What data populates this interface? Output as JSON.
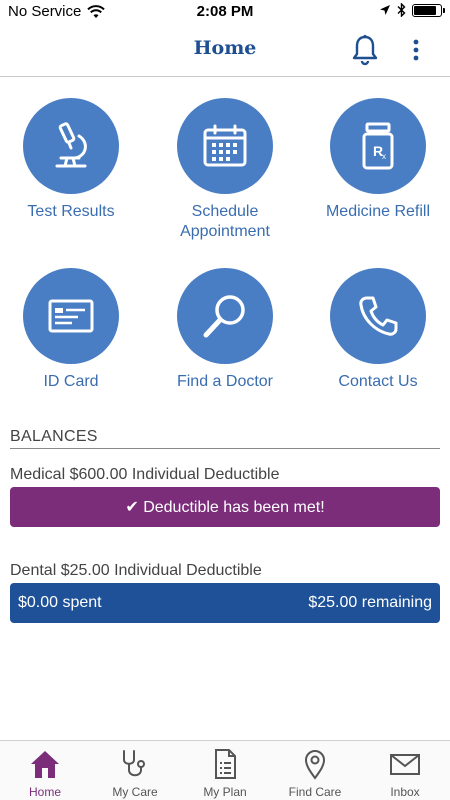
{
  "status": {
    "carrier": "No Service",
    "time": "2:08 PM"
  },
  "header": {
    "title": "Home"
  },
  "tiles": [
    {
      "label": "Test Results",
      "icon": "microscope-icon"
    },
    {
      "label": "Schedule Appointment",
      "icon": "calendar-icon"
    },
    {
      "label": "Medicine Refill",
      "icon": "pill-bottle-icon"
    },
    {
      "label": "ID Card",
      "icon": "id-card-icon"
    },
    {
      "label": "Find a Doctor",
      "icon": "magnifier-icon"
    },
    {
      "label": "Contact Us",
      "icon": "phone-icon"
    }
  ],
  "balances": {
    "heading": "BALANCES",
    "medical": {
      "caption": "Medical $600.00 Individual Deductible",
      "status": "✔ Deductible has been met!"
    },
    "dental": {
      "caption": "Dental $25.00 Individual Deductible",
      "spent": "$0.00 spent",
      "remaining": "$25.00 remaining"
    }
  },
  "tabs": [
    {
      "label": "Home",
      "icon": "home-icon",
      "active": true
    },
    {
      "label": "My Care",
      "icon": "stethoscope-icon"
    },
    {
      "label": "My Plan",
      "icon": "document-icon"
    },
    {
      "label": "Find Care",
      "icon": "map-pin-icon"
    },
    {
      "label": "Inbox",
      "icon": "envelope-icon"
    }
  ],
  "colors": {
    "brand_blue": "#1d4f91",
    "tile_blue": "#4a7ec4",
    "met_purple": "#7b2d7a",
    "dental_blue": "#1e5197"
  }
}
